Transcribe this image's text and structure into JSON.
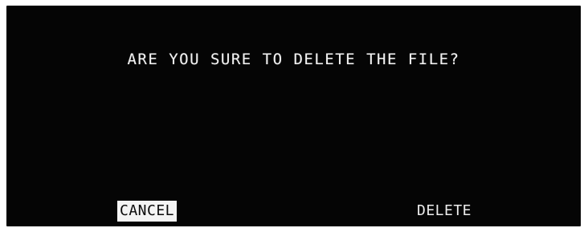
{
  "dialog": {
    "message": "ARE YOU SURE TO DELETE THE FILE?",
    "cancel_label": "CANCEL",
    "delete_label": "DELETE",
    "selected_button": "CANCEL"
  },
  "colors": {
    "screen_background": "#050505",
    "text": "#f2f2f2",
    "selected_button_background": "#f4f4f4",
    "selected_button_text": "#0a0a0a"
  }
}
